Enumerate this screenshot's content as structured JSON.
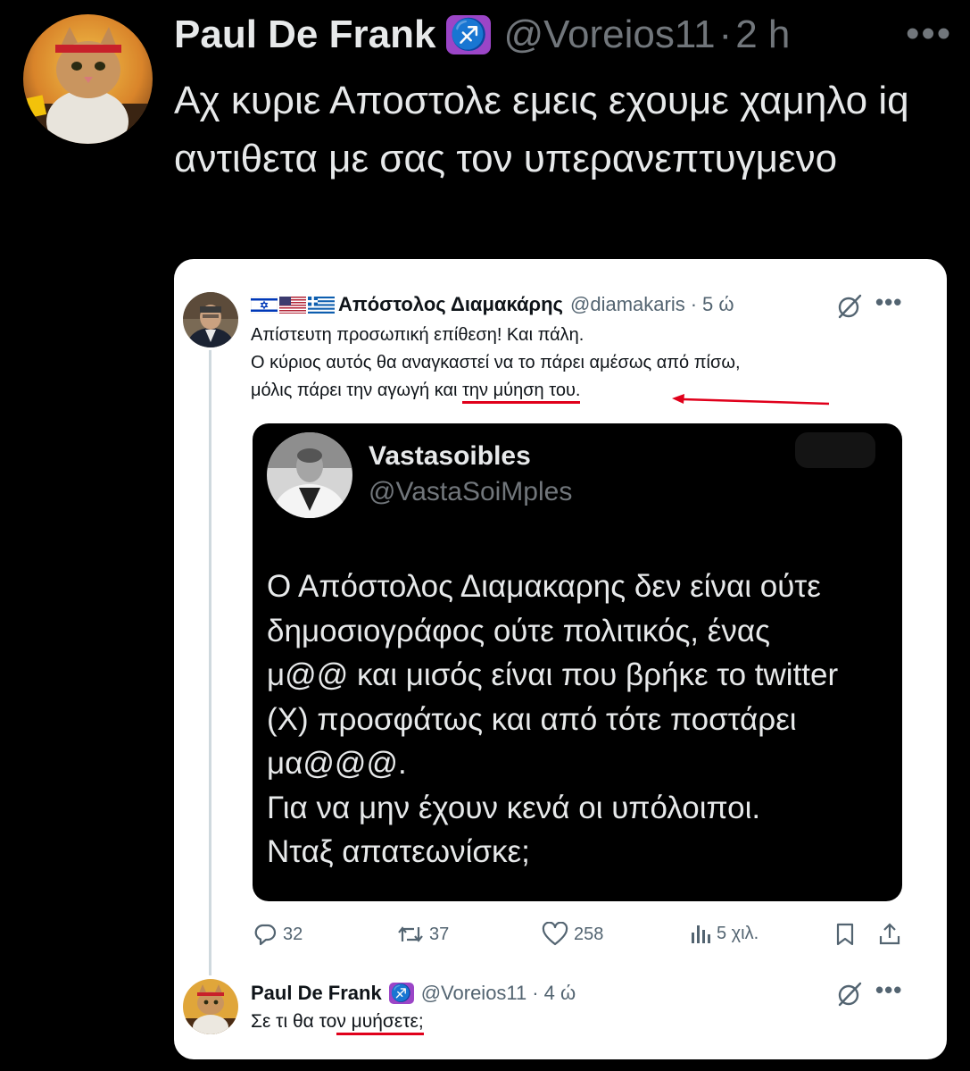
{
  "outer_tweet": {
    "display_name": "Paul De Frank",
    "badge_glyph": "♐",
    "handle": "@Voreios11",
    "separator": "·",
    "time": "2 h",
    "more": "•••",
    "text": "Αχ κυριε Αποστολε εμεις εχουμε χαμηλο iq αντιθετα με σας τον υπερανεπτυγμενο"
  },
  "quoted_tweet": {
    "display_name": "Απόστολος Διαμακάρης",
    "flags": [
      "israel-flag-icon",
      "usa-flag-icon",
      "greece-flag-icon"
    ],
    "handle": "@diamakaris",
    "separator": "·",
    "time": "5 ώ",
    "more": "•••",
    "body_line1": "Απίστευτη προσωπική επίθεση! Και πάλη.",
    "body_line2": "Ο κύριος αυτός θα αναγκαστεί να το πάρει αμέσως από πίσω,",
    "body_line3_prefix": "μόλις πάρει την αγωγή και ",
    "body_line3_underlined": "την μύηση του.",
    "embedded_image": {
      "display_name": "Vastasoibles",
      "handle": "@VastaSoiMples",
      "text_lines": [
        "Ο Απόστολος Διαμακαρης δεν είναι ούτε",
        "δημοσιογράφος ούτε πολιτικός, ένας",
        "μ@@ και μισός είναι που βρήκε το twitter",
        "(X) προσφάτως και από τότε ποστάρει",
        "μα@@@.",
        "Για να μην έχουν κενά οι υπόλοιποι.",
        "Νταξ απατεωνίσκε;"
      ]
    },
    "actions": {
      "replies": "32",
      "reposts": "37",
      "likes": "258",
      "views": "5 χιλ."
    }
  },
  "reply_tweet": {
    "display_name": "Paul De Frank",
    "badge_glyph": "♐",
    "handle": "@Voreios11",
    "separator": "·",
    "time": "4 ώ",
    "more": "•••",
    "body_prefix": "Σε τι θα το",
    "body_underlined": "ν μυήσετε;"
  },
  "colors": {
    "background": "#000000",
    "card_background": "#ffffff",
    "badge_purple": "#9b45c7",
    "muted_gray": "#71767b",
    "annotation_red": "#e0001b"
  }
}
